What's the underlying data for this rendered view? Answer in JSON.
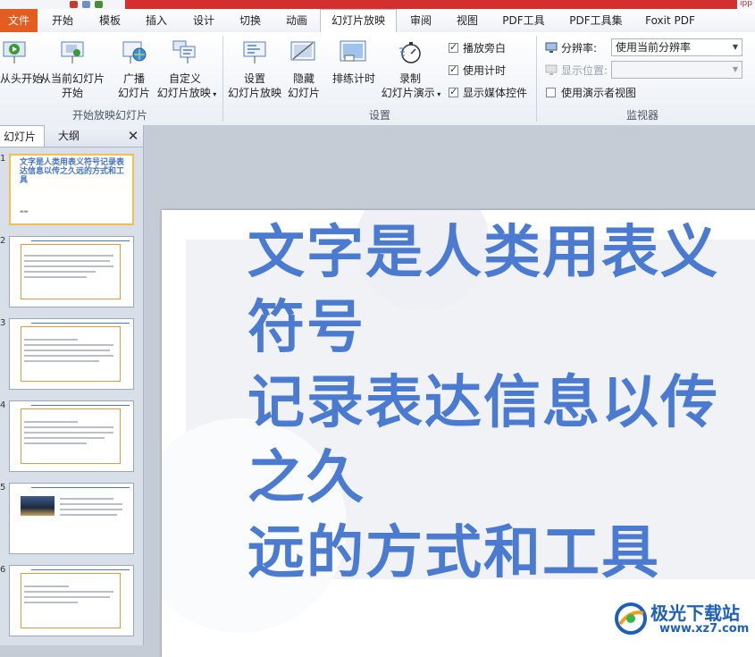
{
  "title_bar": {
    "right_fragment": "ıpp"
  },
  "ribbon_tabs": [
    {
      "label": "文件"
    },
    {
      "label": "开始"
    },
    {
      "label": "模板"
    },
    {
      "label": "插入"
    },
    {
      "label": "设计"
    },
    {
      "label": "切换"
    },
    {
      "label": "动画"
    },
    {
      "label": "幻灯片放映"
    },
    {
      "label": "审阅"
    },
    {
      "label": "视图"
    },
    {
      "label": "PDF工具"
    },
    {
      "label": "PDF工具集"
    },
    {
      "label": "Foxit PDF"
    }
  ],
  "groups": {
    "start": {
      "title": "开始放映幻灯片",
      "from_begin": "从头开始",
      "from_current_1": "从当前幻灯片",
      "from_current_2": "开始",
      "broadcast_1": "广播",
      "broadcast_2": "幻灯片",
      "custom_1": "自定义",
      "custom_2": "幻灯片放映"
    },
    "setup": {
      "title": "设置",
      "setup_show_1": "设置",
      "setup_show_2": "幻灯片放映",
      "hide_1": "隐藏",
      "hide_2": "幻灯片",
      "rehearse": "排练计时",
      "record_1": "录制",
      "record_2": "幻灯片演示",
      "cb_narration": "播放旁白",
      "cb_timing": "使用计时",
      "cb_media": "显示媒体控件"
    },
    "monitor": {
      "title": "监视器",
      "resolution_label": "分辨率:",
      "resolution_value": "使用当前分辨率",
      "display_label": "显示位置:",
      "display_value": "",
      "presenter_view": "使用演示者视图"
    }
  },
  "panel": {
    "tab_slides": "幻灯片",
    "tab_outline": "大纲",
    "close": "✕",
    "slide_numbers": [
      "1",
      "2",
      "3",
      "4",
      "5",
      "6"
    ],
    "thumb1_title": "文字是人类用表义符号记录表达信息以传之久远的方式和工具"
  },
  "slide": {
    "title": "文字是人类用表义符号\n记录表达信息以传之久\n远的方式和工具"
  },
  "watermark": {
    "name": "极光下载站",
    "url": "www.xz7.com"
  },
  "colors": {
    "accent_red": "#d32f2f",
    "file_tab": "#e25d1f",
    "title_blue": "#4a7bd0",
    "select_border": "#f0c050"
  }
}
